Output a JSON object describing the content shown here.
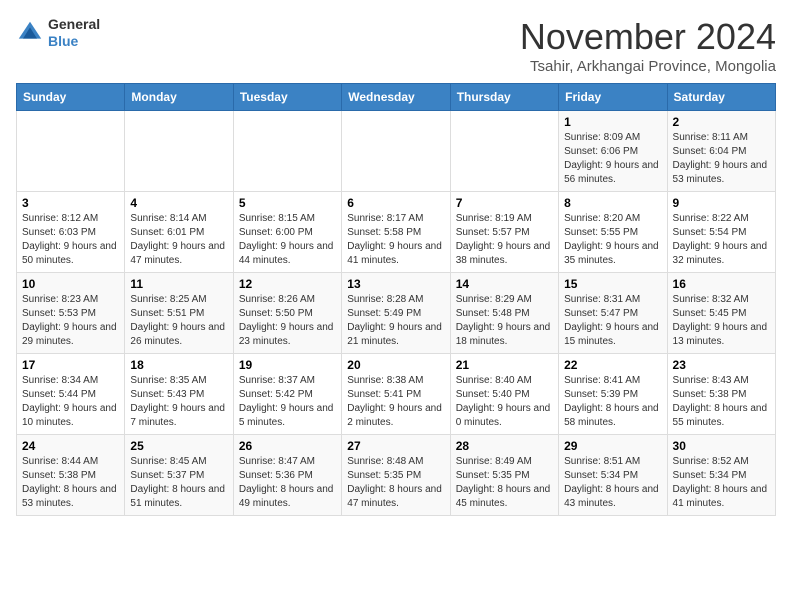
{
  "logo": {
    "text_general": "General",
    "text_blue": "Blue"
  },
  "title": "November 2024",
  "subtitle": "Tsahir, Arkhangai Province, Mongolia",
  "weekdays": [
    "Sunday",
    "Monday",
    "Tuesday",
    "Wednesday",
    "Thursday",
    "Friday",
    "Saturday"
  ],
  "weeks": [
    [
      {
        "day": "",
        "sunrise": "",
        "sunset": "",
        "daylight": ""
      },
      {
        "day": "",
        "sunrise": "",
        "sunset": "",
        "daylight": ""
      },
      {
        "day": "",
        "sunrise": "",
        "sunset": "",
        "daylight": ""
      },
      {
        "day": "",
        "sunrise": "",
        "sunset": "",
        "daylight": ""
      },
      {
        "day": "",
        "sunrise": "",
        "sunset": "",
        "daylight": ""
      },
      {
        "day": "1",
        "sunrise": "Sunrise: 8:09 AM",
        "sunset": "Sunset: 6:06 PM",
        "daylight": "Daylight: 9 hours and 56 minutes."
      },
      {
        "day": "2",
        "sunrise": "Sunrise: 8:11 AM",
        "sunset": "Sunset: 6:04 PM",
        "daylight": "Daylight: 9 hours and 53 minutes."
      }
    ],
    [
      {
        "day": "3",
        "sunrise": "Sunrise: 8:12 AM",
        "sunset": "Sunset: 6:03 PM",
        "daylight": "Daylight: 9 hours and 50 minutes."
      },
      {
        "day": "4",
        "sunrise": "Sunrise: 8:14 AM",
        "sunset": "Sunset: 6:01 PM",
        "daylight": "Daylight: 9 hours and 47 minutes."
      },
      {
        "day": "5",
        "sunrise": "Sunrise: 8:15 AM",
        "sunset": "Sunset: 6:00 PM",
        "daylight": "Daylight: 9 hours and 44 minutes."
      },
      {
        "day": "6",
        "sunrise": "Sunrise: 8:17 AM",
        "sunset": "Sunset: 5:58 PM",
        "daylight": "Daylight: 9 hours and 41 minutes."
      },
      {
        "day": "7",
        "sunrise": "Sunrise: 8:19 AM",
        "sunset": "Sunset: 5:57 PM",
        "daylight": "Daylight: 9 hours and 38 minutes."
      },
      {
        "day": "8",
        "sunrise": "Sunrise: 8:20 AM",
        "sunset": "Sunset: 5:55 PM",
        "daylight": "Daylight: 9 hours and 35 minutes."
      },
      {
        "day": "9",
        "sunrise": "Sunrise: 8:22 AM",
        "sunset": "Sunset: 5:54 PM",
        "daylight": "Daylight: 9 hours and 32 minutes."
      }
    ],
    [
      {
        "day": "10",
        "sunrise": "Sunrise: 8:23 AM",
        "sunset": "Sunset: 5:53 PM",
        "daylight": "Daylight: 9 hours and 29 minutes."
      },
      {
        "day": "11",
        "sunrise": "Sunrise: 8:25 AM",
        "sunset": "Sunset: 5:51 PM",
        "daylight": "Daylight: 9 hours and 26 minutes."
      },
      {
        "day": "12",
        "sunrise": "Sunrise: 8:26 AM",
        "sunset": "Sunset: 5:50 PM",
        "daylight": "Daylight: 9 hours and 23 minutes."
      },
      {
        "day": "13",
        "sunrise": "Sunrise: 8:28 AM",
        "sunset": "Sunset: 5:49 PM",
        "daylight": "Daylight: 9 hours and 21 minutes."
      },
      {
        "day": "14",
        "sunrise": "Sunrise: 8:29 AM",
        "sunset": "Sunset: 5:48 PM",
        "daylight": "Daylight: 9 hours and 18 minutes."
      },
      {
        "day": "15",
        "sunrise": "Sunrise: 8:31 AM",
        "sunset": "Sunset: 5:47 PM",
        "daylight": "Daylight: 9 hours and 15 minutes."
      },
      {
        "day": "16",
        "sunrise": "Sunrise: 8:32 AM",
        "sunset": "Sunset: 5:45 PM",
        "daylight": "Daylight: 9 hours and 13 minutes."
      }
    ],
    [
      {
        "day": "17",
        "sunrise": "Sunrise: 8:34 AM",
        "sunset": "Sunset: 5:44 PM",
        "daylight": "Daylight: 9 hours and 10 minutes."
      },
      {
        "day": "18",
        "sunrise": "Sunrise: 8:35 AM",
        "sunset": "Sunset: 5:43 PM",
        "daylight": "Daylight: 9 hours and 7 minutes."
      },
      {
        "day": "19",
        "sunrise": "Sunrise: 8:37 AM",
        "sunset": "Sunset: 5:42 PM",
        "daylight": "Daylight: 9 hours and 5 minutes."
      },
      {
        "day": "20",
        "sunrise": "Sunrise: 8:38 AM",
        "sunset": "Sunset: 5:41 PM",
        "daylight": "Daylight: 9 hours and 2 minutes."
      },
      {
        "day": "21",
        "sunrise": "Sunrise: 8:40 AM",
        "sunset": "Sunset: 5:40 PM",
        "daylight": "Daylight: 9 hours and 0 minutes."
      },
      {
        "day": "22",
        "sunrise": "Sunrise: 8:41 AM",
        "sunset": "Sunset: 5:39 PM",
        "daylight": "Daylight: 8 hours and 58 minutes."
      },
      {
        "day": "23",
        "sunrise": "Sunrise: 8:43 AM",
        "sunset": "Sunset: 5:38 PM",
        "daylight": "Daylight: 8 hours and 55 minutes."
      }
    ],
    [
      {
        "day": "24",
        "sunrise": "Sunrise: 8:44 AM",
        "sunset": "Sunset: 5:38 PM",
        "daylight": "Daylight: 8 hours and 53 minutes."
      },
      {
        "day": "25",
        "sunrise": "Sunrise: 8:45 AM",
        "sunset": "Sunset: 5:37 PM",
        "daylight": "Daylight: 8 hours and 51 minutes."
      },
      {
        "day": "26",
        "sunrise": "Sunrise: 8:47 AM",
        "sunset": "Sunset: 5:36 PM",
        "daylight": "Daylight: 8 hours and 49 minutes."
      },
      {
        "day": "27",
        "sunrise": "Sunrise: 8:48 AM",
        "sunset": "Sunset: 5:35 PM",
        "daylight": "Daylight: 8 hours and 47 minutes."
      },
      {
        "day": "28",
        "sunrise": "Sunrise: 8:49 AM",
        "sunset": "Sunset: 5:35 PM",
        "daylight": "Daylight: 8 hours and 45 minutes."
      },
      {
        "day": "29",
        "sunrise": "Sunrise: 8:51 AM",
        "sunset": "Sunset: 5:34 PM",
        "daylight": "Daylight: 8 hours and 43 minutes."
      },
      {
        "day": "30",
        "sunrise": "Sunrise: 8:52 AM",
        "sunset": "Sunset: 5:34 PM",
        "daylight": "Daylight: 8 hours and 41 minutes."
      }
    ]
  ]
}
